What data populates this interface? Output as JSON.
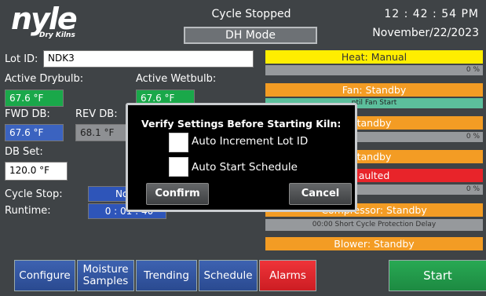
{
  "header": {
    "logo_main": "nyle",
    "logo_sub": "Dry Kilns",
    "cycle_status": "Cycle Stopped",
    "mode": "DH Mode",
    "time": "12 : 42 : 54  PM",
    "date": "November/22/2023"
  },
  "left": {
    "lot_label": "Lot ID:",
    "lot_value": "NDK3",
    "active_drybulb_label": "Active Drybulb:",
    "active_wetbulb_label": "Active Wetbulb:",
    "active_drybulb_value": "67.6 °F",
    "active_wetbulb_value": "67.6 °F",
    "fwd_db_label": "FWD DB:",
    "rev_db_label": "REV DB:",
    "fwd_db_value": "67.6 °F",
    "rev_db_value": "68.1 °F",
    "db_set_label": "DB Set:",
    "db_set_value": "120.0 °F",
    "cycle_stop_label": "Cycle Stop:",
    "cycle_stop_value": "Nov/2",
    "runtime_label": "Runtime:",
    "runtime_value": "0 : 01 : 40"
  },
  "status": {
    "heat": "Heat: Manual",
    "heat_pct": "0 %",
    "fan": "Fan: Standby",
    "fan_sub": "ntil Fan Start",
    "standby1": "tandby",
    "standby1_pct": "0 %",
    "standby2": "tandby",
    "faulted": "aulted",
    "faulted_pct": "0 %",
    "compressor": "Compressor: Standby",
    "compressor_sub": "00:00 Short Cycle Protection Delay",
    "blower": "Blower: Standby"
  },
  "dialog": {
    "title": "Verify Settings Before Starting Kiln:",
    "opt1": "Auto Increment Lot ID",
    "opt2": "Auto Start Schedule",
    "confirm": "Confirm",
    "cancel": "Cancel"
  },
  "nav": {
    "configure": "Configure",
    "moisture": "Moisture Samples",
    "trending": "Trending",
    "schedule": "Schedule",
    "alarms": "Alarms",
    "start": "Start"
  }
}
